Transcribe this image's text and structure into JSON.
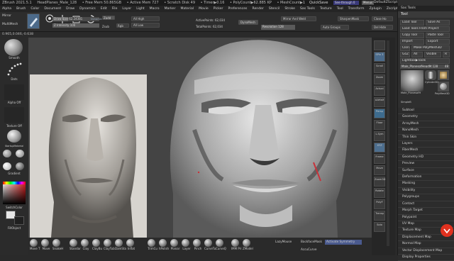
{
  "titlebar": {
    "app": "ZBrush 2021.5.1",
    "doc": "HeadPlanes_Male_128",
    "free_mem": "• Free Mem 50.865GB",
    "active_mem": "• Active Mem 727",
    "scratch_disk": "• Scratch Disk 49",
    "timer": "• Timer▶0.16",
    "polycount": "• PolyCount▶62.885 KP",
    "meshcount": "• MeshCount▶1",
    "quicksave": "QuickSave",
    "see_through": "See-through 0",
    "menus": "Menus",
    "default_zscript": "DefaultZScript"
  },
  "menubar": [
    "Alpha",
    "Brush",
    "Color",
    "Document",
    "Draw",
    "Dynamics",
    "Edit",
    "File",
    "Layer",
    "Light",
    "Macro",
    "Marker",
    "Material",
    "Movie",
    "Picker",
    "Preferences",
    "Render",
    "Stencil",
    "Stroke",
    "Sas Tools",
    "Texture",
    "Tool",
    "Transform",
    "Zplugin",
    "Zscript",
    "Help"
  ],
  "toolbar": {
    "mirror": "Mirror",
    "multimesh": "MultiMesh",
    "draw_size_label": "Draw Size 62.24381",
    "dynamic": "Dynamic",
    "zadd": "Zadd",
    "zsub": "Zsub",
    "rgb": "Rgb",
    "z_intensity": "Z Intensity 100",
    "all_high": "All High",
    "all_low": "All Low",
    "active_points": "ActivePoints: 62,034",
    "total_points": "TotalPoints: 62,034",
    "dynamesh": "DynaMesh",
    "mirror_weld": "Mirror And Weld",
    "sharpen_mask": "SharpenMask",
    "close_holes": "Close Ho",
    "auto_groups": "Auto Groups",
    "resolution": "Resolution 128",
    "del_hidden": "Del Hide"
  },
  "subbar": {
    "coords": "0.965,0.046,-0.638"
  },
  "leftshelf": {
    "smooth": "Smooth",
    "dots": "Dots",
    "alpha_off": "Alpha Off",
    "texture_off": "Texture Off",
    "matcap": "StartupMaterial",
    "gradient": "Gradient",
    "switch_color": "SwitchColor",
    "fill_object": "FillObject",
    "primary_color": "#e6e6e6",
    "secondary_color": "#202020"
  },
  "bottom_brushes": [
    "Move T",
    "Move",
    "SnakeH",
    "Standar",
    "Clay",
    "ClayBu",
    "ClayTub",
    "DamSta",
    "Inflat",
    "TrimCu",
    "hPolish",
    "Planar",
    "Layer",
    "Pinch",
    "CurveTu",
    "CurveQ",
    "IMM Pri",
    "ZModel"
  ],
  "bottom_tools": {
    "lazymouse": "LazyMouse",
    "backfacemask": "BackfaceMask",
    "activate_symmetry": "Activate Symmetry",
    "accucurve": "AccuCurve"
  },
  "rightshelf": {
    "scroll": "Scroll",
    "zoom": "Zoom",
    "actual": "Actual",
    "aahalf": "AAHalf",
    "persp": "Persp",
    "floor": "Floor",
    "lsym": "L.Sym",
    "xyz": "XYZ",
    "frame": "Frame",
    "move": "Move",
    "zoom3d": "Zoom3D",
    "rotate": "Rotate",
    "polyf": "PolyF",
    "transp": "Transp",
    "solo": "Solo",
    "spix": "SPix 3"
  },
  "panel": {
    "header_close": "Sas Tools",
    "title": "Tool",
    "load_tool": "Load Tool",
    "save_as": "Save As",
    "load_from_project": "Load Tools From Project",
    "copy_tool": "Copy Tool",
    "paste_tool": "Paste Tool",
    "import": "Import",
    "export": "Export",
    "clone": "Clone",
    "make_polymesh": "Make PolyMesh3D",
    "goz": "GoZ",
    "all": "All",
    "visible": "Visible",
    "r": "R",
    "lightbox_tools": "Lightbox▶Tools",
    "current_tool": "Male_PlanesofHeadM.128",
    "tool_count": "48",
    "thumb1": "Male_PlanesofH",
    "thumb2": "Cylinder3D",
    "thumb3": "PolyMesh3D",
    "thumb4": "SimpleB",
    "list": [
      "Subtool",
      "Geometry",
      "ArrayMesh",
      "NanoMesh",
      "Thin Skin",
      "Layers",
      "FiberMesh",
      "Geometry HD",
      "Preview",
      "Surface",
      "Deformation",
      "Masking",
      "Visibility",
      "Polygroups",
      "Contact",
      "Morph Target",
      "Polypaint",
      "UV Map",
      "Texture Map",
      "Displacement Map",
      "Normal Map",
      "Vector Displacement Map",
      "Display Properties"
    ]
  }
}
